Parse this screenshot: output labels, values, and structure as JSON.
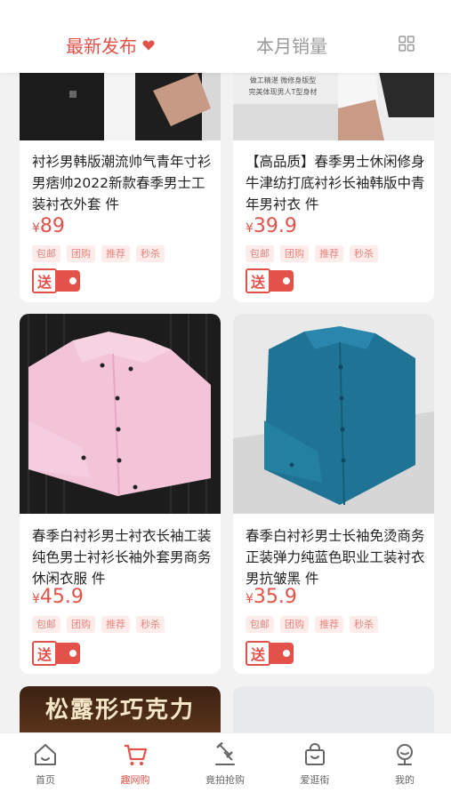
{
  "sort_bar": {
    "latest_label": "最新发布",
    "monthly_sales_label": "本月销量"
  },
  "products": [
    {
      "title": "衬衫男韩版潮流帅气青年寸衫男痞帅2022新款春季男士工装衬衣外套 件",
      "price_symbol": "¥",
      "price": "89",
      "tags": [
        "包邮",
        "团购",
        "推荐",
        "秒杀"
      ],
      "gift_label": "送",
      "image_caption": ""
    },
    {
      "title": "【高品质】春季男士休闲修身牛津纺打底衬衫长袖韩版中青年男衬衣 件",
      "price_symbol": "¥",
      "price": "39.9",
      "tags": [
        "包邮",
        "团购",
        "推荐",
        "秒杀"
      ],
      "gift_label": "送",
      "image_caption": "做工精湛 微修身版型\n完美体现男人T型身材"
    },
    {
      "title": "春季白衬衫男士衬衣长袖工装纯色男士衬衫长袖外套男商务休闲衣服 件",
      "price_symbol": "¥",
      "price": "45.9",
      "tags": [
        "包邮",
        "团购",
        "推荐",
        "秒杀"
      ],
      "gift_label": "送"
    },
    {
      "title": "春季白衬衫男士长袖免烫商务正装弹力纯蓝色职业工装衬衣男抗皱黑 件",
      "price_symbol": "¥",
      "price": "35.9",
      "tags": [
        "包邮",
        "团购",
        "推荐",
        "秒杀"
      ],
      "gift_label": "送"
    },
    {
      "banner_text": "松露形巧克力"
    }
  ],
  "tabbar": [
    {
      "label": "首页",
      "icon": "home-icon"
    },
    {
      "label": "趣网购",
      "icon": "cart-icon",
      "active": true
    },
    {
      "label": "竟拍抢购",
      "icon": "gavel-icon"
    },
    {
      "label": "爱逛街",
      "icon": "shopping-bag-icon"
    },
    {
      "label": "我的",
      "icon": "profile-icon"
    }
  ],
  "colors": {
    "accent": "#e2524a",
    "tag_bg": "#fdecea",
    "tag_text": "#e9847d"
  }
}
